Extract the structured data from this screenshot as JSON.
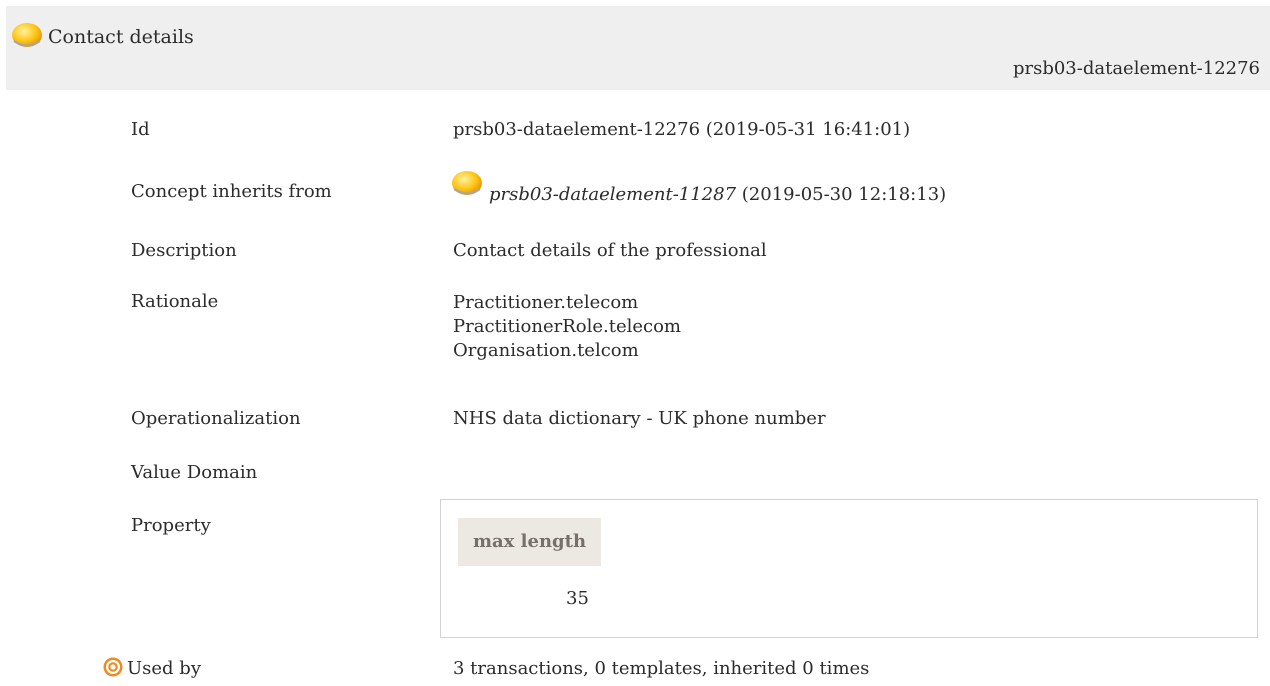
{
  "header": {
    "title": "Contact details",
    "id": "prsb03-dataelement-12276",
    "status_color": "#ffc61a"
  },
  "rows": {
    "id": {
      "label": "Id",
      "value": "prsb03-dataelement-12276 (2019-05-31 16:41:01)"
    },
    "inherits": {
      "label": "Concept inherits from",
      "ref": "prsb03-dataelement-11287",
      "date": "(2019-05-30 12:18:13)"
    },
    "description": {
      "label": "Description",
      "value": "Contact details of the professional"
    },
    "rationale": {
      "label": "Rationale",
      "lines": [
        "Practitioner.telecom",
        "PractitionerRole.telecom",
        "Organisation.telcom"
      ]
    },
    "operationalization": {
      "label": "Operationalization",
      "value": "NHS data dictionary - UK phone number"
    },
    "value_domain": {
      "label": "Value Domain"
    },
    "property": {
      "label": "Property",
      "column_header": "max length",
      "value": "35"
    },
    "used_by": {
      "label": "Used by",
      "value": "3 transactions, 0 templates, inherited 0 times",
      "icon_color": "#f08a1c"
    }
  }
}
